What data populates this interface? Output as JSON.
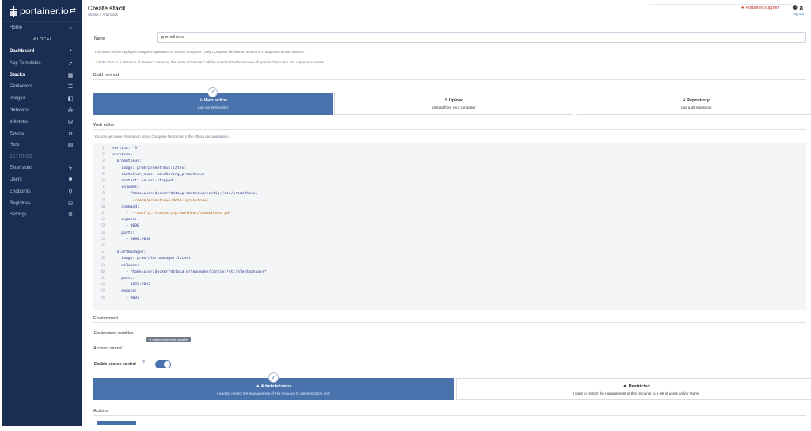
{
  "sidebar": {
    "brand": "portainer.io",
    "endpoint_label": "LOCAL",
    "settings_heading": "SETTINGS",
    "items": [
      {
        "label": "Home",
        "icon": "home-icon",
        "glyph": "⌂"
      },
      {
        "label": "Dashboard",
        "icon": "dashboard-icon",
        "glyph": "◔"
      },
      {
        "label": "App Templates",
        "icon": "rocket-icon",
        "glyph": "➚"
      },
      {
        "label": "Stacks",
        "icon": "stacks-icon",
        "glyph": "▦"
      },
      {
        "label": "Containers",
        "icon": "containers-icon",
        "glyph": "☰"
      },
      {
        "label": "Images",
        "icon": "images-icon",
        "glyph": "◧"
      },
      {
        "label": "Networks",
        "icon": "network-icon",
        "glyph": "⁂"
      },
      {
        "label": "Volumes",
        "icon": "volumes-icon",
        "glyph": "⛁"
      },
      {
        "label": "Events",
        "icon": "history-icon",
        "glyph": "↺"
      },
      {
        "label": "Host",
        "icon": "host-icon",
        "glyph": "▤"
      }
    ],
    "settings_items": [
      {
        "label": "Extensions",
        "icon": "bolt-icon",
        "glyph": "ϟ"
      },
      {
        "label": "Users",
        "icon": "users-icon",
        "glyph": "☻"
      },
      {
        "label": "Endpoints",
        "icon": "plug-icon",
        "glyph": "⚲"
      },
      {
        "label": "Registries",
        "icon": "database-icon",
        "glyph": "⛁"
      },
      {
        "label": "Settings",
        "icon": "cogs-icon",
        "glyph": "⚙"
      }
    ]
  },
  "header": {
    "title": "Create stack",
    "breadcrumb": "Stacks > Add stack",
    "support": "Portainer support",
    "user": "a",
    "logout": "log out"
  },
  "form": {
    "name_label": "Name",
    "name_value": "prometheus",
    "info_line": "This stack will be deployed using the equivalent of 'docker-compose'. Only Compose file format version 3 is supported at the moment.",
    "note_line": "Note: Due to a limitation of Docker Compose, the name of the stack will be standardized to remove all special characters and uppercase letters.",
    "build_method_title": "Build method",
    "methods": [
      {
        "title": "Web editor",
        "desc": "Use our Web editor",
        "icon": "edit-icon",
        "glyph": "✎"
      },
      {
        "title": "Upload",
        "desc": "Upload from your computer",
        "icon": "upload-icon",
        "glyph": "⇪"
      },
      {
        "title": "Repository",
        "desc": "Use a git repository",
        "icon": "git-icon",
        "glyph": "⑂"
      }
    ],
    "web_editor_title": "Web editor",
    "web_editor_hint": "You can get more information about Compose file format in the official documentation.",
    "code": [
      {
        "n": "1",
        "text": "version: '3'"
      },
      {
        "n": "2",
        "text": "services:"
      },
      {
        "n": "3",
        "text": "  prometheus:"
      },
      {
        "n": "4",
        "text": "    image: prom/prometheus:latest"
      },
      {
        "n": "5",
        "text": "    container_name: monitoring_prometheus"
      },
      {
        "n": "6",
        "text": "    restart: unless-stopped"
      },
      {
        "n": "7",
        "text": "    volumes:"
      },
      {
        "n": "8",
        "text": "      - /home/user/docker/data/prometheus/config:/etc/prometheus/"
      },
      {
        "n": "9",
        "text": "      - ../data/prometheus/data:/prometheus",
        "str": true
      },
      {
        "n": "10",
        "text": "    command:"
      },
      {
        "n": "11",
        "text": "      - '--config.file=/etc/prometheus/prometheus.yml'",
        "str": true
      },
      {
        "n": "12",
        "text": "    expose:"
      },
      {
        "n": "13",
        "text": "      - 9090"
      },
      {
        "n": "14",
        "text": "    ports:"
      },
      {
        "n": "15",
        "text": "      - 9090:9090"
      },
      {
        "n": "16",
        "text": ""
      },
      {
        "n": "17",
        "text": "  alertmanager:"
      },
      {
        "n": "18",
        "text": "    image: prom/alertmanager:latest"
      },
      {
        "n": "19",
        "text": "    volumes:"
      },
      {
        "n": "20",
        "text": "      - /home/user/docker/data/alertmanager/config:/etc/alertmanager/"
      },
      {
        "n": "21",
        "text": "    ports:"
      },
      {
        "n": "22",
        "text": "      - 9093:9093"
      },
      {
        "n": "23",
        "text": "    expose:"
      },
      {
        "n": "24",
        "text": "      - 9093"
      }
    ],
    "environment_title": "Environment",
    "env_label": "Environment variables",
    "env_button": "add environment variable",
    "access_title": "Access control",
    "access_toggle_label": "Enable access control",
    "access_enabled": true,
    "access_options": [
      {
        "title": "Administrators",
        "desc": "I want to restrict the management of this resource to administrators only",
        "icon": "users-icon",
        "glyph": "☻"
      },
      {
        "title": "Restricted",
        "desc": "I want to restrict the management of this resource to a set of users and/or teams",
        "icon": "users-icon",
        "glyph": "☻"
      }
    ],
    "actions_title": "Actions"
  },
  "colors": {
    "sidebar_bg": "#1a2e53",
    "accent": "#4a73ae",
    "support_red": "#c0392b"
  }
}
